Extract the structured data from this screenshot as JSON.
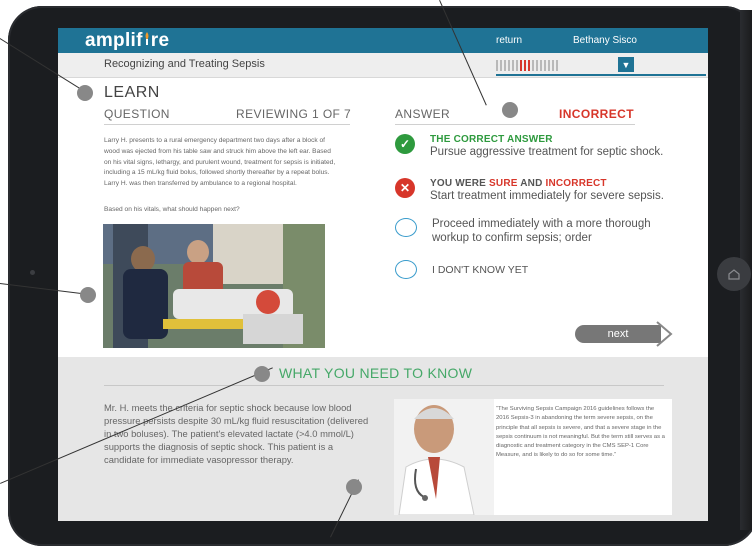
{
  "app": {
    "logo": "amplif re",
    "nav_return": "return",
    "user_name": "Bethany Sisco"
  },
  "course": {
    "title": "Recognizing and Treating Sepsis"
  },
  "progress": {
    "ticks_total": 16,
    "red_ticks": [
      6,
      7,
      8
    ],
    "dropdown_icon": "chevron-down-icon"
  },
  "learn": {
    "heading": "LEARN"
  },
  "question": {
    "header": "QUESTION",
    "reviewing": "REVIEWING 1 OF 7",
    "body": "Larry H. presents to a rural emergency department two days after a block of wood was ejected from his table saw and struck him above the left ear. Based on his vital signs, lethargy, and purulent wound, treatment for sepsis is initiated, including a 15 mL/kg fluid bolus, followed shortly thereafter by a repeat bolus. Larry H. was then transferred by ambulance to a regional hospital.",
    "prompt": "Based on his vitals, what should happen next?"
  },
  "answer": {
    "header": "ANSWER",
    "status": "INCORRECT",
    "correct_label": "THE CORRECT ANSWER",
    "correct_text": "Pursue aggressive treatment for septic shock.",
    "wrong_label_prefix": "YOU WERE ",
    "wrong_label_sure": "SURE",
    "wrong_label_and": " AND ",
    "wrong_label_incorrect": "INCORRECT",
    "wrong_text": "Start treatment immediately for severe sepsis.",
    "option3_text": "Proceed immediately with a more thorough workup to confirm sepsis; order",
    "option4_text": "I DON'T KNOW YET",
    "next_label": "next"
  },
  "need_to_know": {
    "heading": "WHAT YOU NEED TO KNOW",
    "explanation": "Mr. H. meets the criteria for septic shock because low blood pressure persists despite 30 mL/kg fluid resuscitation (delivered in two boluses). The patient's elevated lactate (>4.0 mmol/L) supports the diagnosis of septic shock. This patient is a candidate for immediate vasopressor therapy.",
    "quote": "“The Surviving Sepsis Campaign 2016 guidelines follows the 2016 Sepsis-3 in abandoning the term severe sepsis, on the principle that all sepsis is severe, and that a severe stage in the sepsis continuum is not meaningful. But the term still serves as a diagnostic and treatment category in the CMS SEP-1 Core Measure, and is likely to do so for some time.”"
  },
  "colors": {
    "brand": "#1f7395",
    "correct": "#2e9a3e",
    "incorrect": "#d7362a",
    "heading_green": "#45a868"
  }
}
